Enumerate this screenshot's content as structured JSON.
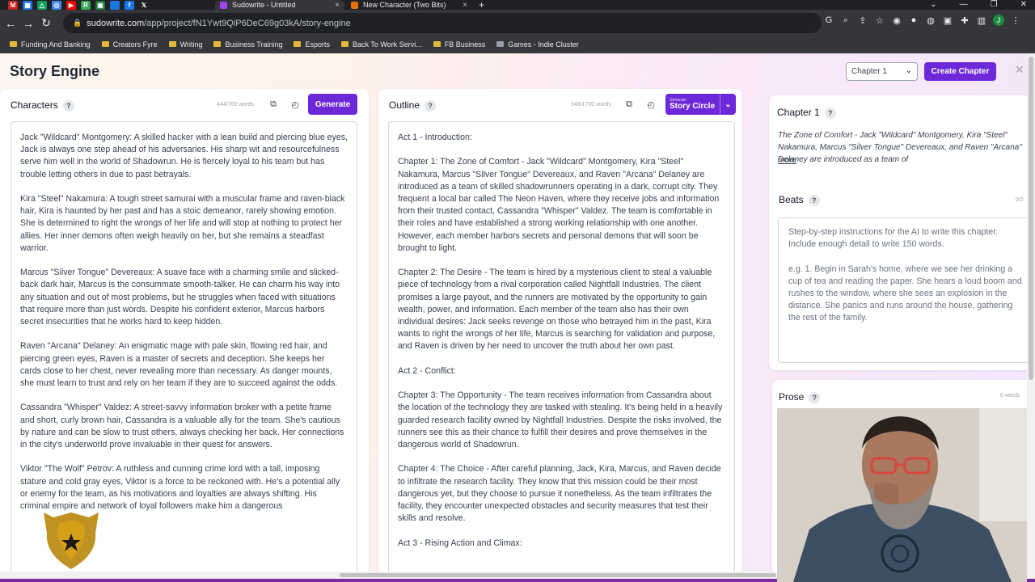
{
  "browser": {
    "tabs": [
      {
        "title": "Sudowrite - Untitled",
        "active": true
      },
      {
        "title": "New Character (Two Bits)",
        "active": false
      }
    ],
    "url_host": "sudowrite.com",
    "url_path": "/app/project/fN1Ywt9QlP6DeC69g03kA/story-engine",
    "profile_initial": "J",
    "bookmarks": [
      "Funding And Banking",
      "Creators Fyre",
      "Writing",
      "Business Training",
      "Esports",
      "Back To Work Servi...",
      "FB Business",
      "Games - Indie Cluster"
    ]
  },
  "app": {
    "title": "Story Engine",
    "chapter_select_value": "Chapter 1",
    "create_chapter_label": "Create Chapter"
  },
  "characters": {
    "title": "Characters",
    "word_count": "444/700 words",
    "generate_label": "Generate",
    "paragraphs": [
      "Jack \"Wildcard\" Montgomery: A skilled hacker with a lean build and piercing blue eyes, Jack is always one step ahead of his adversaries. His sharp wit and resourcefulness serve him well in the world of Shadowrun. He is fiercely loyal to his team but has trouble letting others in due to past betrayals.",
      "Kira \"Steel\" Nakamura: A tough street samurai with a muscular frame and raven-black hair, Kira is haunted by her past and has a stoic demeanor, rarely showing emotion. She is determined to right the wrongs of her life and will stop at nothing to protect her allies. Her inner demons often weigh heavily on her, but she remains a steadfast warrior.",
      "Marcus \"Silver Tongue\" Devereaux: A suave face with a charming smile and slicked-back dark hair, Marcus is the consummate smooth-talker. He can charm his way into any situation and out of most problems, but he struggles when faced with situations that require more than just words. Despite his confident exterior, Marcus harbors secret insecurities that he works hard to keep hidden.",
      "Raven \"Arcana\" Delaney: An enigmatic mage with pale skin, flowing red hair, and piercing green eyes, Raven is a master of secrets and deception. She keeps her cards close to her chest, never revealing more than necessary. As danger mounts, she must learn to trust and rely on her team if they are to succeed against the odds.",
      "Cassandra \"Whisper\" Valdez: A street-savvy information broker with a petite frame and short, curly brown hair, Cassandra is a valuable ally for the team. She's cautious by nature and can be slow to trust others, always checking her back. Her connections in the city's underworld prove invaluable in their quest for answers.",
      "Viktor \"The Wolf\" Petrov: A ruthless and cunning crime lord with a tall, imposing stature and cold gray eyes, Viktor is a force to be reckoned with. He's a potential ally or enemy for the team, as his motivations and loyalties are always shifting. His criminal empire and network of loyal followers make him a dangerous"
    ]
  },
  "outline": {
    "title": "Outline",
    "word_count": "348/1700 words",
    "generate_small": "Generate",
    "generate_label": "Story Circle",
    "paragraphs": [
      "Act 1 - Introduction:",
      "Chapter 1: The Zone of Comfort - Jack \"Wildcard\" Montgomery, Kira \"Steel\" Nakamura, Marcus \"Silver Tongue\" Devereaux, and Raven \"Arcana\" Delaney are introduced as a team of skilled shadowrunners operating in a dark, corrupt city. They frequent a local bar called The Neon Haven, where they receive jobs and information from their trusted contact, Cassandra \"Whisper\" Valdez. The team is comfortable in their roles and have established a strong working relationship with one another. However, each member harbors secrets and personal demons that will soon be brought to light.",
      "Chapter 2: The Desire - The team is hired by a mysterious client to steal a valuable piece of technology from a rival corporation called Nightfall Industries. The client promises a large payout, and the runners are motivated by the opportunity to gain wealth, power, and information. Each member of the team also has their own individual desires: Jack seeks revenge on those who betrayed him in the past, Kira wants to right the wrongs of her life, Marcus is searching for validation and purpose, and Raven is driven by her need to uncover the truth about her own past.",
      "Act 2 - Conflict:",
      "Chapter 3: The Opportunity - The team receives information from Cassandra about the location of the technology they are tasked with stealing. It's being held in a heavily guarded research facility owned by Nightfall Industries. Despite the risks involved, the runners see this as their chance to fulfill their desires and prove themselves in the dangerous world of Shadowrun.",
      "Chapter 4: The Choice - After careful planning, Jack, Kira, Marcus, and Raven decide to infiltrate the research facility. They know that this mission could be their most dangerous yet, but they choose to pursue it nonetheless. As the team infiltrates the facility, they encounter unexpected obstacles and security measures that test their skills and resolve.",
      "Act 3 - Rising Action and Climax:"
    ]
  },
  "chapter": {
    "title": "Chapter 1",
    "summary": "The Zone of Comfort - Jack \"Wildcard\" Montgomery, Kira \"Steel\" Nakamura, Marcus \"Silver Tongue\" Devereaux, and Raven \"Arcana\" Delaney are introduced as a team of",
    "more_label": "more",
    "beats_title": "Beats",
    "beats_count": "0/2",
    "beats_placeholder_1": "Step-by-step instructions for the AI to write this chapter. Include enough detail to write 150 words.",
    "beats_placeholder_2": "e.g. 1. Begin in Sarah's home, where we see her drinking a cup of tea and reading the paper. She hears a loud boom and rushes to the window, where she sees an explosion in the distance. She panics and runs around the house, gathering the rest of the family.",
    "prose_title": "Prose",
    "prose_count": "0 words"
  }
}
